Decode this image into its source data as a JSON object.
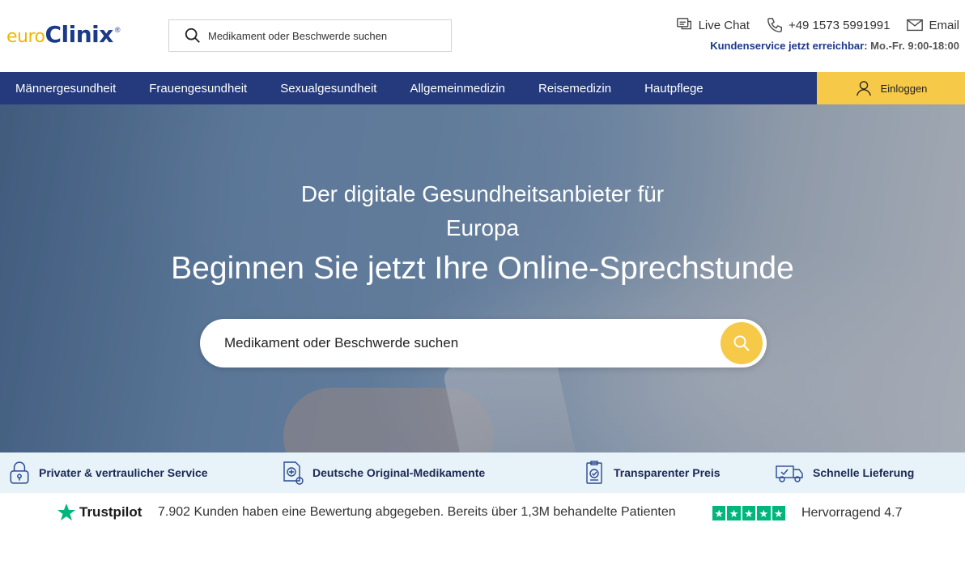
{
  "header": {
    "logo": {
      "euro": "euro",
      "clinix": "Clinix",
      "reg": "®"
    },
    "search_placeholder": "Medikament oder Beschwerde suchen",
    "contact": {
      "live_chat": "Live Chat",
      "phone": "+49 1573 5991991",
      "email": "Email"
    },
    "service": {
      "label": "Kundenservice jetzt erreichbar:",
      "hours": "Mo.-Fr. 9:00-18:00"
    }
  },
  "nav": {
    "items": [
      {
        "label": "Männergesundheit"
      },
      {
        "label": "Frauengesundheit"
      },
      {
        "label": "Sexualgesundheit"
      },
      {
        "label": "Allgemeinmedizin"
      },
      {
        "label": "Reisemedizin"
      },
      {
        "label": "Hautpflege"
      }
    ],
    "login_label": "Einloggen"
  },
  "hero": {
    "title_line1": "Der digitale Gesundheitsanbieter für",
    "title_line2": "Europa",
    "subtitle": "Beginnen Sie jetzt Ihre Online-Sprechstunde",
    "search_placeholder": "Medikament oder Beschwerde suchen"
  },
  "usp": [
    {
      "label": "Privater & vertraulicher Service",
      "icon": "lock-icon"
    },
    {
      "label": "Deutsche Original-Medikamente",
      "icon": "medicine-icon"
    },
    {
      "label": "Transparenter Preis",
      "icon": "price-check-icon"
    },
    {
      "label": "Schnelle Lieferung",
      "icon": "delivery-truck-icon"
    }
  ],
  "trust": {
    "brand": "Trustpilot",
    "text": "7.902 Kunden haben eine Bewertung abgegeben. Bereits über 1,3M behandelte Patienten",
    "stars": 5,
    "rating": "Hervorragend 4.7"
  },
  "colors": {
    "brand_blue": "#243a7c",
    "accent_yellow": "#f7c948",
    "trustpilot_green": "#00b67a",
    "usp_bg": "#e7f2f9"
  }
}
